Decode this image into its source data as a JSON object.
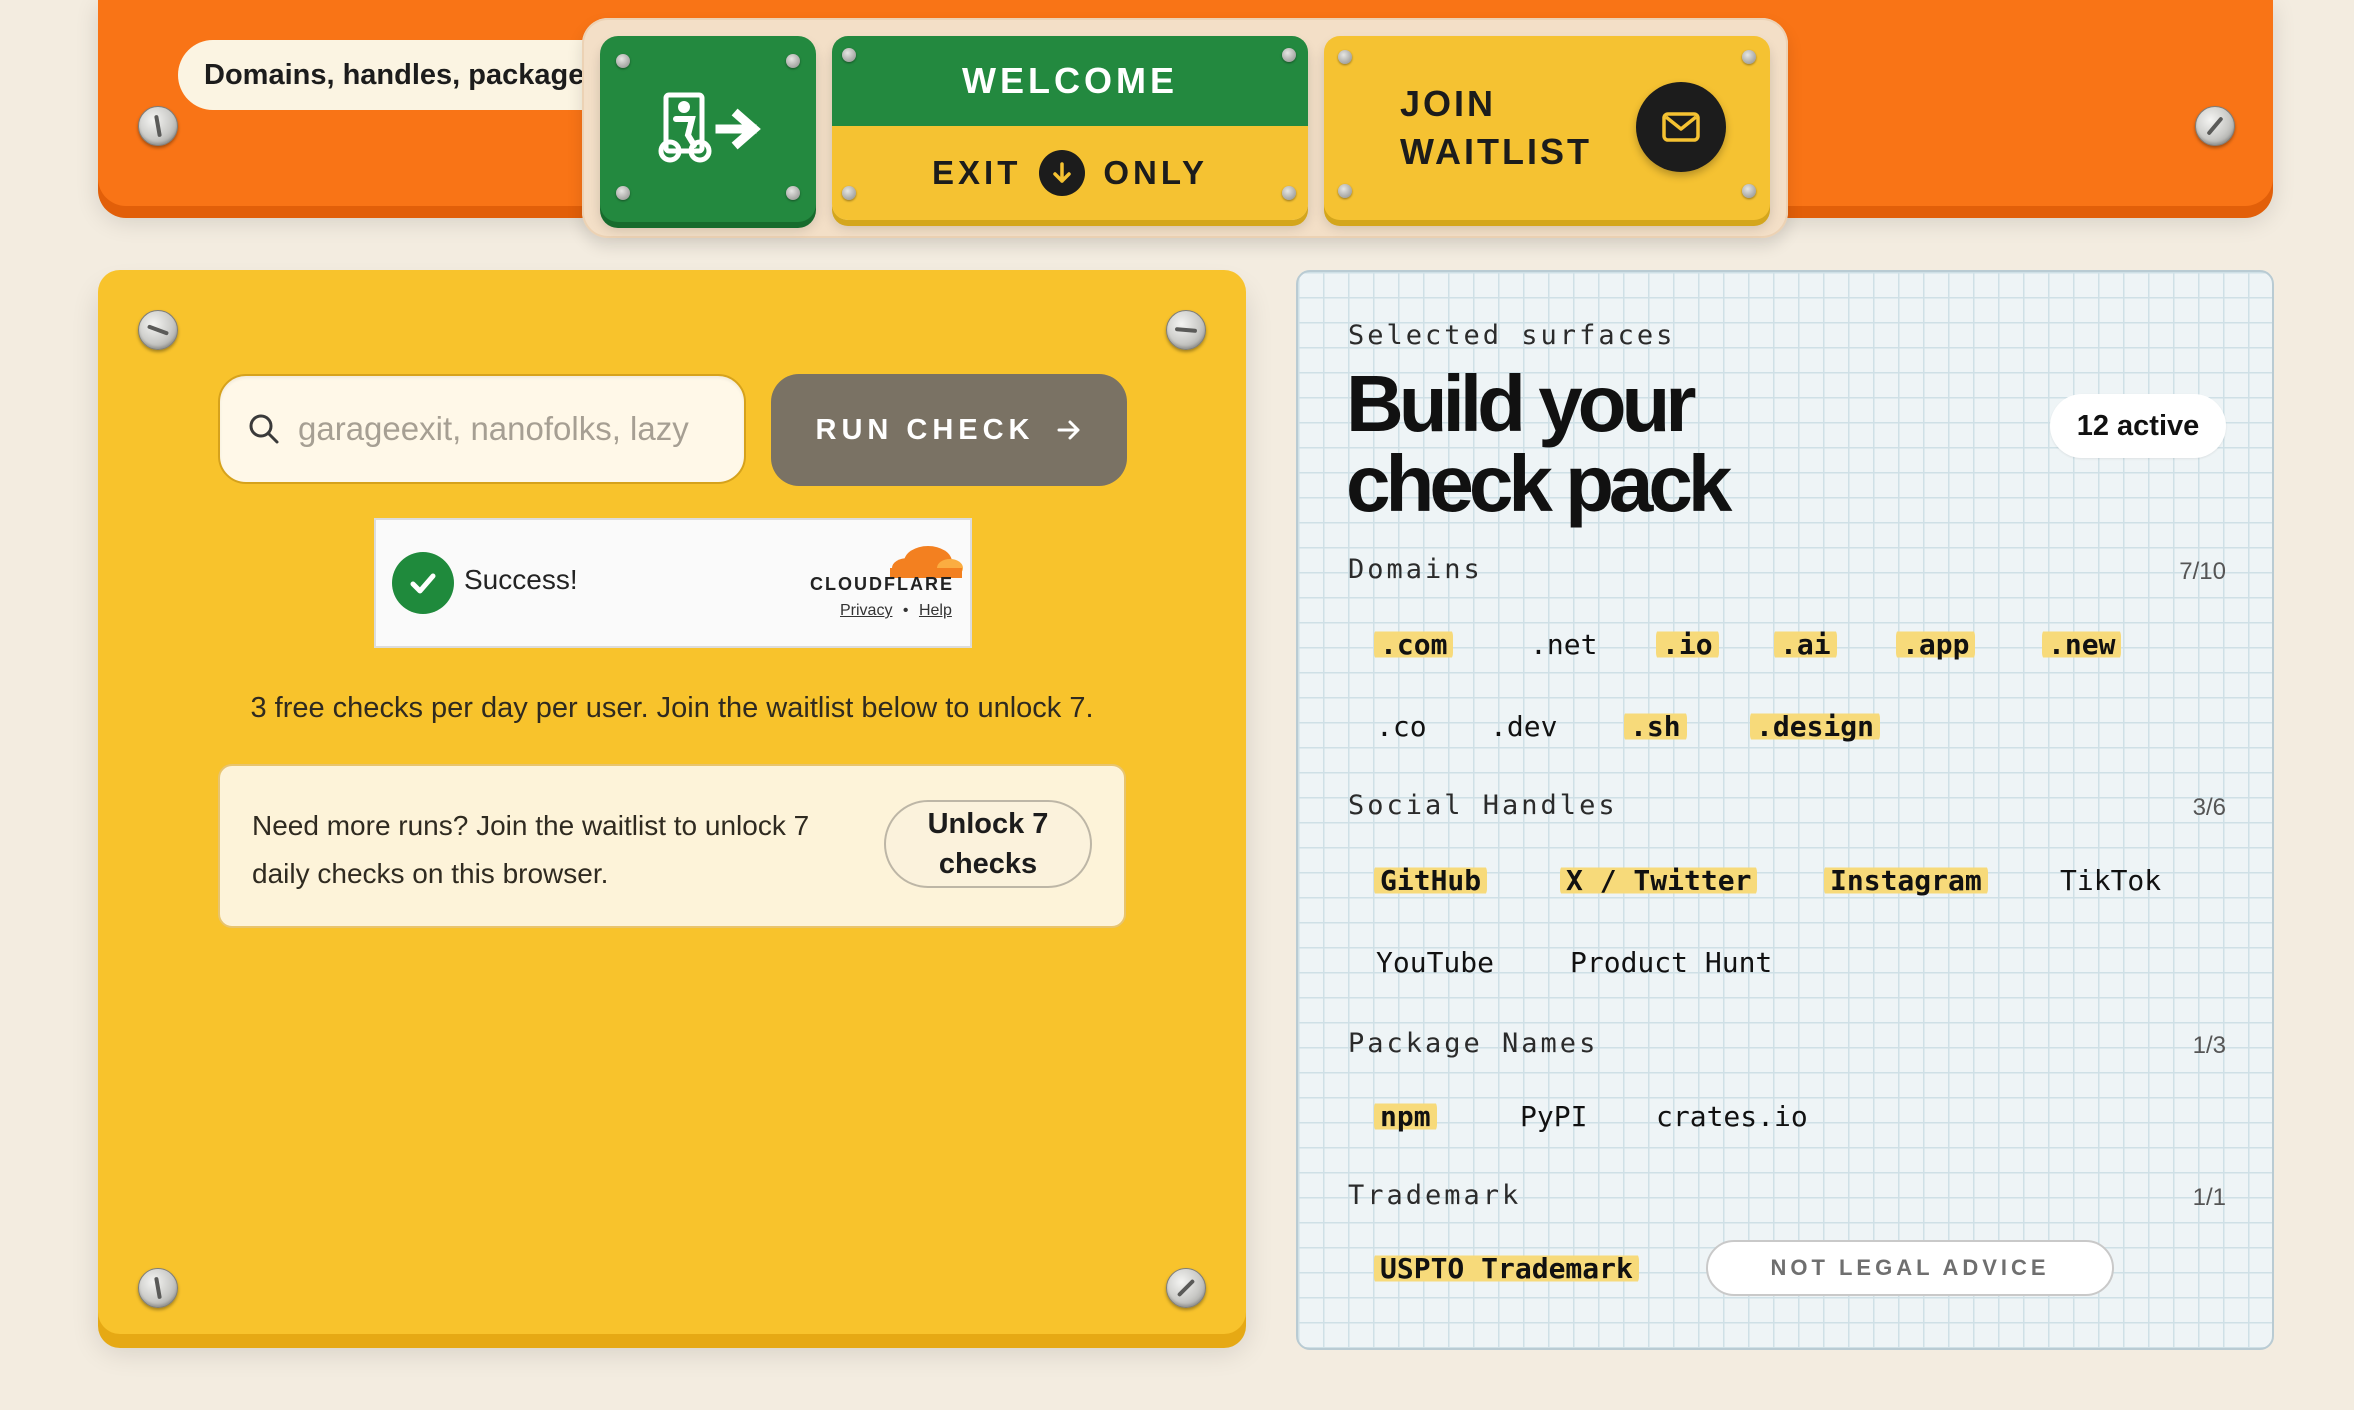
{
  "header": {
    "pill_text": "Domains, handles, packages",
    "sign": {
      "welcome": "WELCOME",
      "exit": "EXIT",
      "only": "ONLY",
      "join_line1": "JOIN",
      "join_line2": "WAITLIST"
    }
  },
  "checker": {
    "search_placeholder": "garageexit, nanofolks, lazy",
    "run_label": "RUN CHECK",
    "turnstile": {
      "status": "Success!",
      "brand": "CLOUDFLARE",
      "privacy": "Privacy",
      "separator": "•",
      "help": "Help"
    },
    "limit_text": "3 free checks per day per user. Join the waitlist below to unlock 7.",
    "unlock_card": {
      "text": "Need more runs? Join the waitlist to unlock 7 daily checks on this browser.",
      "button_line1": "Unlock 7",
      "button_line2": "checks"
    }
  },
  "pack": {
    "label": "Selected surfaces",
    "title_line1": "Build your",
    "title_line2": "check pack",
    "active_badge": "12 active",
    "sections": [
      {
        "title": "Domains",
        "count": "7/10",
        "items": [
          {
            "label": ".com",
            "on": true
          },
          {
            "label": ".net",
            "on": false
          },
          {
            "label": ".io",
            "on": true
          },
          {
            "label": ".ai",
            "on": true
          },
          {
            "label": ".app",
            "on": true
          },
          {
            "label": ".new",
            "on": true
          },
          {
            "label": ".co",
            "on": false
          },
          {
            "label": ".dev",
            "on": false
          },
          {
            "label": ".sh",
            "on": true
          },
          {
            "label": ".design",
            "on": true
          }
        ]
      },
      {
        "title": "Social Handles",
        "count": "3/6",
        "items": [
          {
            "label": "GitHub",
            "on": true
          },
          {
            "label": "X / Twitter",
            "on": true
          },
          {
            "label": "Instagram",
            "on": true
          },
          {
            "label": "TikTok",
            "on": false
          },
          {
            "label": "YouTube",
            "on": false
          },
          {
            "label": "Product Hunt",
            "on": false
          }
        ]
      },
      {
        "title": "Package Names",
        "count": "1/3",
        "items": [
          {
            "label": "npm",
            "on": true
          },
          {
            "label": "PyPI",
            "on": false
          },
          {
            "label": "crates.io",
            "on": false
          }
        ]
      },
      {
        "title": "Trademark",
        "count": "1/1",
        "items": [
          {
            "label": "USPTO Trademark",
            "on": true
          }
        ]
      }
    ],
    "legal_badge": "NOT LEGAL ADVICE"
  },
  "colors": {
    "orange": "#f97416",
    "yellow": "#f8c32c",
    "green": "#23893f",
    "run_button": "#7a7264",
    "highlight": "#f7da7a"
  },
  "icons": [
    "exit-sign-icon",
    "arrow-down-icon",
    "mail-icon",
    "search-icon",
    "arrow-right-icon",
    "checkmark-icon",
    "cloudflare-logo"
  ]
}
